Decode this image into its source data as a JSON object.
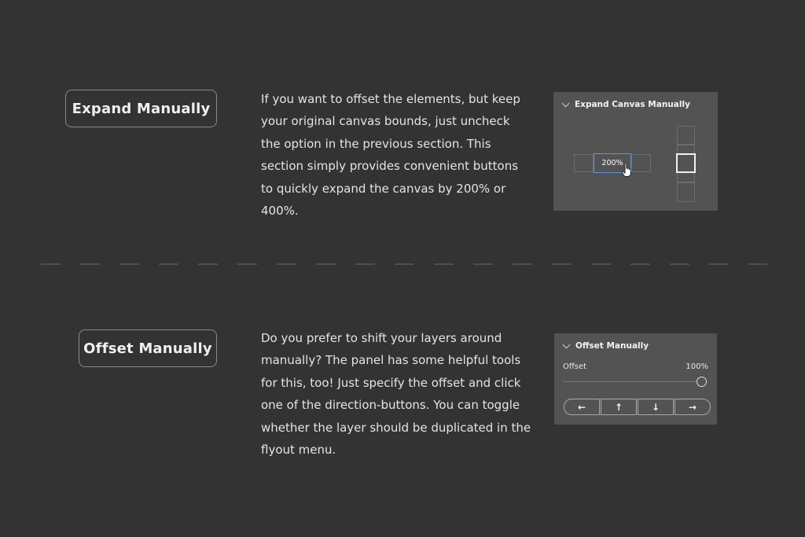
{
  "sections": [
    {
      "title": "Expand Manually",
      "description": "If you want to offset the elements, but keep your original canvas bounds, just uncheck the option in the previous section. This section simply provides convenient buttons to quickly expand the canvas by 200% or 400%."
    },
    {
      "title": "Offset Manually",
      "description": "Do you prefer to shift your layers around manually? The panel has some helpful tools for this, too! Just specify the offset and click one of the direction-buttons. You can toggle whether the layer should be duplicated in the flyout menu."
    }
  ],
  "expand_panel": {
    "header": "Expand Canvas Manually",
    "selected_option": "200%"
  },
  "offset_panel": {
    "header": "Offset Manually",
    "offset_label": "Offset",
    "offset_value": "100%",
    "slider_fraction": 1.0,
    "buttons": [
      {
        "icon": "arrow-left-icon",
        "glyph": "←"
      },
      {
        "icon": "arrow-up-icon",
        "glyph": "↑"
      },
      {
        "icon": "arrow-down-icon",
        "glyph": "↓"
      },
      {
        "icon": "arrow-right-icon",
        "glyph": "→"
      }
    ]
  },
  "colors": {
    "background": "#333333",
    "panel": "#535353",
    "accent_blue": "#5b93d8"
  }
}
